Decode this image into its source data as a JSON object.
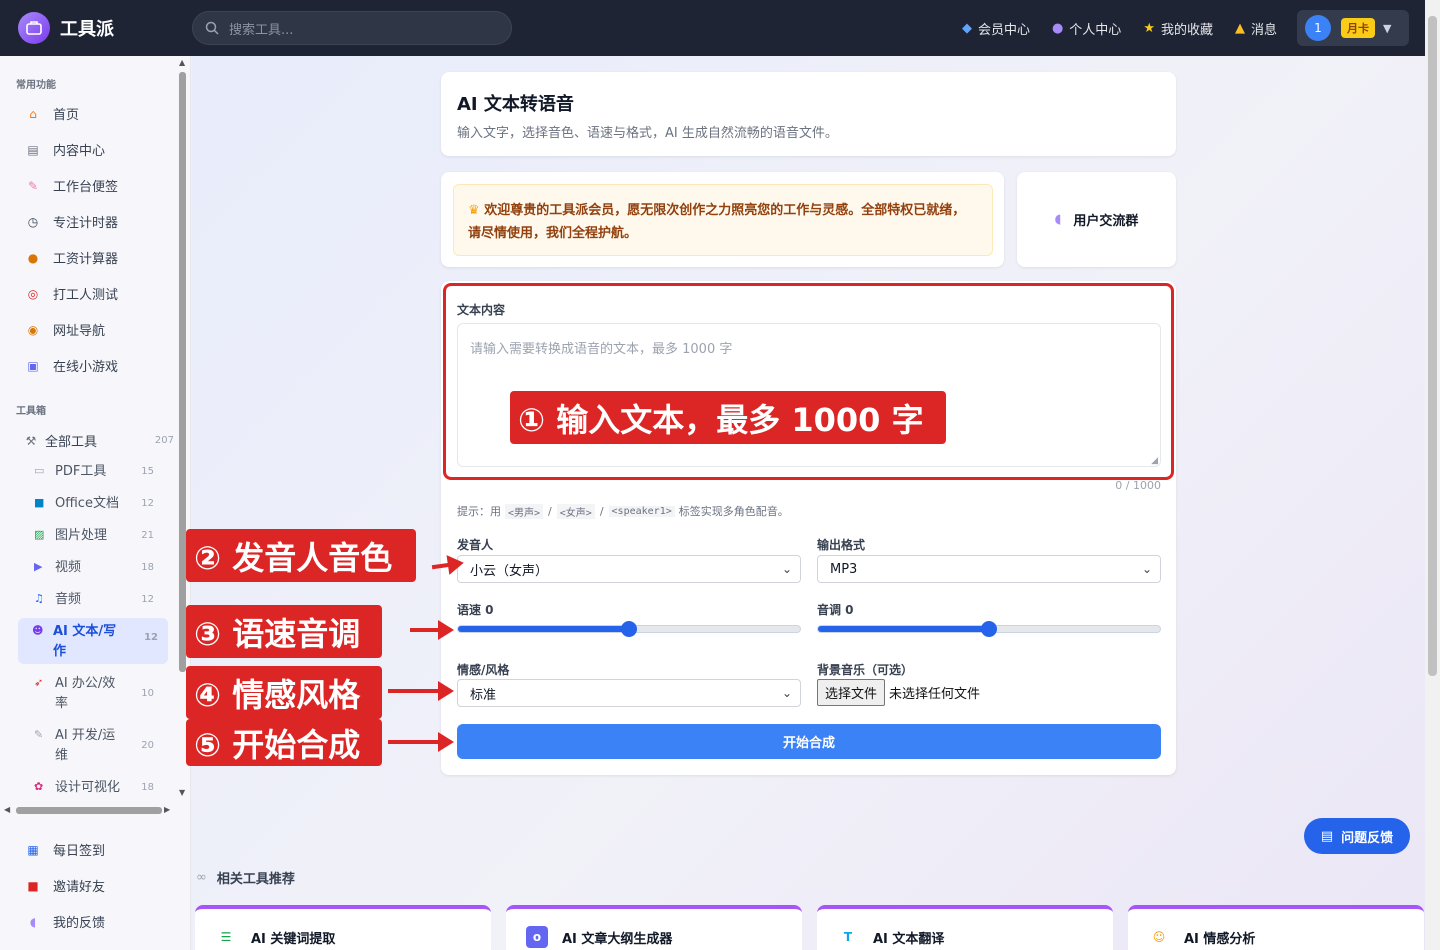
{
  "app": {
    "name": "工具派"
  },
  "search": {
    "placeholder": "搜索工具..."
  },
  "topnav": {
    "items": [
      {
        "label": "会员中心",
        "icon": "diamond-icon"
      },
      {
        "label": "个人中心",
        "icon": "user-icon"
      },
      {
        "label": "我的收藏",
        "icon": "star-icon"
      },
      {
        "label": "消息",
        "icon": "bell-icon"
      }
    ],
    "user": {
      "avatar_text": "1",
      "badge": "月卡"
    }
  },
  "sidebar": {
    "section_common": "常用功能",
    "common": [
      {
        "label": "首页",
        "icon": "home-icon"
      },
      {
        "label": "内容中心",
        "icon": "document-icon"
      },
      {
        "label": "工作台便签",
        "icon": "note-icon"
      },
      {
        "label": "专注计时器",
        "icon": "timer-icon"
      },
      {
        "label": "工资计算器",
        "icon": "money-bag-icon"
      },
      {
        "label": "打工人测试",
        "icon": "target-icon"
      },
      {
        "label": "网址导航",
        "icon": "compass-icon"
      },
      {
        "label": "在线小游戏",
        "icon": "gamepad-icon"
      }
    ],
    "section_tools": "工具箱",
    "all_tools": {
      "label": "全部工具",
      "count": "207"
    },
    "categories": [
      {
        "label": "PDF工具",
        "count": "15"
      },
      {
        "label": "Office文档",
        "count": "12"
      },
      {
        "label": "图片处理",
        "count": "21"
      },
      {
        "label": "视频",
        "count": "18"
      },
      {
        "label": "音频",
        "count": "12"
      },
      {
        "label": "AI 文本/写作",
        "count": "12"
      },
      {
        "label": "AI 办公/效率",
        "count": "10"
      },
      {
        "label": "AI 开发/运维",
        "count": "20"
      },
      {
        "label": "设计可视化",
        "count": "18"
      }
    ],
    "bottom": [
      {
        "label": "每日签到"
      },
      {
        "label": "邀请好友"
      },
      {
        "label": "我的反馈"
      }
    ]
  },
  "header": {
    "title": "AI 文本转语音",
    "subtitle": "输入文字，选择音色、语速与格式，AI 生成自然流畅的语音文件。"
  },
  "welcome": {
    "text": "欢迎尊贵的工具派会员，愿无限次创作之力照亮您的工作与灵感。全部特权已就绪，请尽情使用，我们全程护航。"
  },
  "group": {
    "label": "用户交流群"
  },
  "form": {
    "text_label": "文本内容",
    "text_placeholder": "请输入需要转换成语音的文本，最多 1000 字",
    "counter": "0 / 1000",
    "hint_prefix": "提示：用",
    "hint_tag1": "<男声>",
    "hint_tag2": "<女声>",
    "hint_tag3": "<speaker1>",
    "hint_suffix": "标签实现多角色配音。",
    "speaker_label": "发音人",
    "speaker_value": "小云（女声）",
    "format_label": "输出格式",
    "format_value": "MP3",
    "speed_label": "语速 0",
    "speed_value": 0.5,
    "pitch_label": "音调 0",
    "pitch_value": 0.5,
    "emotion_label": "情感/风格",
    "emotion_value": "标准",
    "bgm_label": "背景音乐（可选）",
    "file_button": "选择文件",
    "file_status": "未选择任何文件",
    "submit": "开始合成"
  },
  "annotations": {
    "a1": "① 输入文本，最多 1000 字",
    "a2": "② 发音人音色",
    "a3": "③ 语速音调",
    "a4": "④ 情感风格",
    "a5": "⑤ 开始合成"
  },
  "feedback": {
    "label": "问题反馈"
  },
  "related": {
    "title": "相关工具推荐",
    "items": [
      {
        "label": "AI 关键词提取"
      },
      {
        "label": "AI 文章大纲生成器"
      },
      {
        "label": "AI 文本翻译"
      },
      {
        "label": "AI 情感分析"
      }
    ]
  },
  "colors": {
    "accent": "#3b82f6",
    "annotation": "#dc2626",
    "topbar": "#1e2433"
  }
}
